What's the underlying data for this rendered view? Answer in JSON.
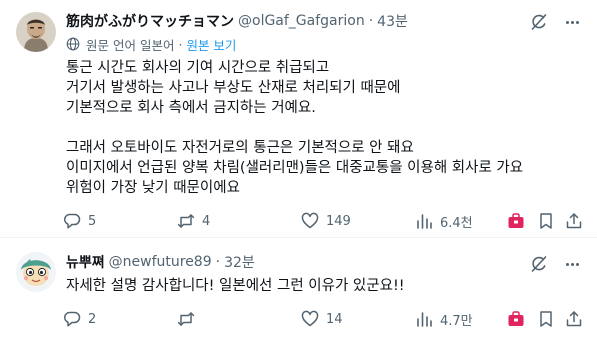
{
  "tweets": [
    {
      "author": {
        "name": "筋肉がふがりマッチョマン",
        "handle": "@olGaf_Gafgarion",
        "time": "43분"
      },
      "translation": {
        "label": "원문 언어 일본어",
        "separator": "·",
        "show_original": "원본 보기"
      },
      "text": [
        "통근 시간도 회사의 기여 시간으로 취급되고",
        "거기서 발생하는 사고나 부상도 산재로 처리되기 때문에",
        "기본적으로 회사 측에서 금지하는 거예요.",
        "",
        "그래서 오토바이도 자전거로의 통근은 기본적으로 안 돼요",
        "이미지에서 언급된 양복 차림(샐러리맨)들은 대중교통을 이용해 회사로 가요",
        "위험이 가장 낮기 때문이에요"
      ],
      "stats": {
        "replies": "5",
        "reposts": "4",
        "likes": "149",
        "views": "6.4천"
      }
    },
    {
      "author": {
        "name": "뉴뿌쪄",
        "handle": "@newfuture89",
        "time": "32분"
      },
      "text": [
        "자세한 설명 감사합니다! 일본에선 그런 이유가 있군요!!"
      ],
      "stats": {
        "replies": "2",
        "reposts": "",
        "likes": "14",
        "views": "4.7만"
      }
    }
  ],
  "dot_separator": "·",
  "icons": [
    "grok-icon",
    "more-icon",
    "globe-icon",
    "reply-icon",
    "repost-icon",
    "like-icon",
    "views-icon",
    "bag-icon",
    "bookmark-icon",
    "share-icon"
  ],
  "colors": {
    "text": "#0f1419",
    "secondary": "#536471",
    "link": "#1d9bf0",
    "divider": "#eff3f4",
    "bag": "#e0245e"
  }
}
